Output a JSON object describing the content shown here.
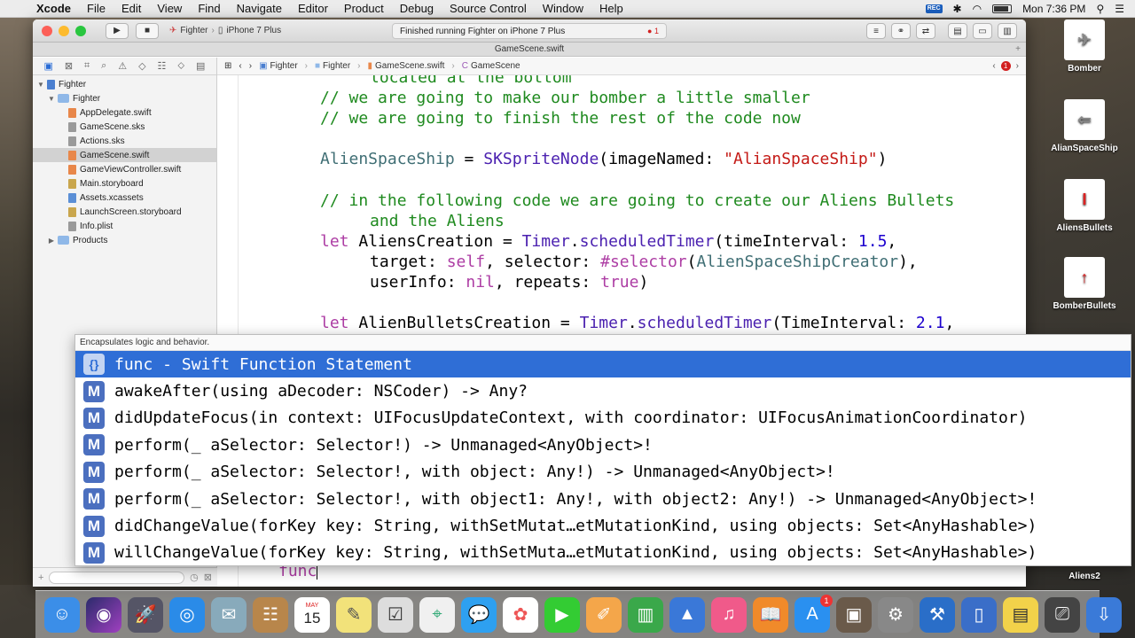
{
  "menubar": {
    "app": "Xcode",
    "items": [
      "File",
      "Edit",
      "View",
      "Find",
      "Navigate",
      "Editor",
      "Product",
      "Debug",
      "Source Control",
      "Window",
      "Help"
    ],
    "rec": "REC",
    "clock": "Mon 7:36 PM"
  },
  "toolbar": {
    "scheme": "Fighter",
    "device": "iPhone 7 Plus",
    "status": "Finished running Fighter on iPhone 7 Plus",
    "error_count": "1"
  },
  "tab": {
    "title": "GameScene.swift"
  },
  "navigator": {
    "project": "Fighter",
    "group": "Fighter",
    "files": [
      {
        "name": "AppDelegate.swift",
        "color": "#e8874a"
      },
      {
        "name": "GameScene.sks",
        "color": "#9a9a9a"
      },
      {
        "name": "Actions.sks",
        "color": "#9a9a9a"
      },
      {
        "name": "GameScene.swift",
        "color": "#e8874a"
      },
      {
        "name": "GameViewController.swift",
        "color": "#e8874a"
      },
      {
        "name": "Main.storyboard",
        "color": "#c9a64d"
      },
      {
        "name": "Assets.xcassets",
        "color": "#5b8fd6"
      },
      {
        "name": "LaunchScreen.storyboard",
        "color": "#c9a64d"
      },
      {
        "name": "Info.plist",
        "color": "#9a9a9a"
      }
    ],
    "products": "Products"
  },
  "jumpbar": {
    "crumbs": [
      "Fighter",
      "Fighter",
      "GameScene.swift",
      "GameScene"
    ],
    "error_count": "1"
  },
  "code": {
    "l1": "located at the bottom",
    "l2": "// we are going to make our bomber a little smaller",
    "l3": "// we are going to finish the rest of the code now",
    "l5a": "AlienSpaceShip",
    "l5b": " = ",
    "l5c": "SKSpriteNode",
    "l5d": "(imageNamed: ",
    "l5e": "\"AlianSpaceShip\"",
    "l5f": ")",
    "l7": "// in the following code we are going to create our Aliens Bullets",
    "l8": "and the Aliens",
    "l9a": "let",
    "l9b": " AliensCreation = ",
    "l9c": "Timer",
    "l9d": ".",
    "l9e": "scheduledTimer",
    "l9f": "(timeInterval: ",
    "l9g": "1.5",
    "l9h": ",",
    "l10a": "target: ",
    "l10b": "self",
    "l10c": ", selector: ",
    "l10d": "#selector",
    "l10e": "(",
    "l10f": "AlienSpaceShipCreator",
    "l10g": "),",
    "l11a": "userInfo: ",
    "l11b": "nil",
    "l11c": ", repeats: ",
    "l11d": "true",
    "l11e": ")",
    "l13a": "let",
    "l13b": " AlienBulletsCreation = ",
    "l13c": "Timer",
    "l13d": ".",
    "l13e": "scheduledTimer",
    "l13f": "(TimeInterval: ",
    "l13g": "2.1",
    "l13h": ",",
    "typed": "func"
  },
  "autocomplete": {
    "description": "Encapsulates logic and behavior.",
    "items": [
      {
        "badge": "{}",
        "text": "func - Swift Function Statement"
      },
      {
        "badge": "M",
        "text": "awakeAfter(using aDecoder: NSCoder) -> Any?"
      },
      {
        "badge": "M",
        "text": "didUpdateFocus(in context: UIFocusUpdateContext, with coordinator: UIFocusAnimationCoordinator)"
      },
      {
        "badge": "M",
        "text": "perform(_ aSelector: Selector!) -> Unmanaged<AnyObject>!"
      },
      {
        "badge": "M",
        "text": "perform(_ aSelector: Selector!, with object: Any!) -> Unmanaged<AnyObject>!"
      },
      {
        "badge": "M",
        "text": "perform(_ aSelector: Selector!, with object1: Any!, with object2: Any!) -> Unmanaged<AnyObject>!"
      },
      {
        "badge": "M",
        "text": "didChangeValue(forKey key: String, withSetMutat…etMutationKind, using objects: Set<AnyHashable>)"
      },
      {
        "badge": "M",
        "text": "willChangeValue(forKey key: String, withSetMuta…etMutationKind, using objects: Set<AnyHashable>)"
      }
    ]
  },
  "desktop_icons": [
    "Bomber",
    "AlianSpaceShip",
    "AliensBullets",
    "BomberBullets",
    "Aliens2"
  ],
  "dock_badge": "1",
  "calendar_day": "15",
  "calendar_month": "MAY"
}
